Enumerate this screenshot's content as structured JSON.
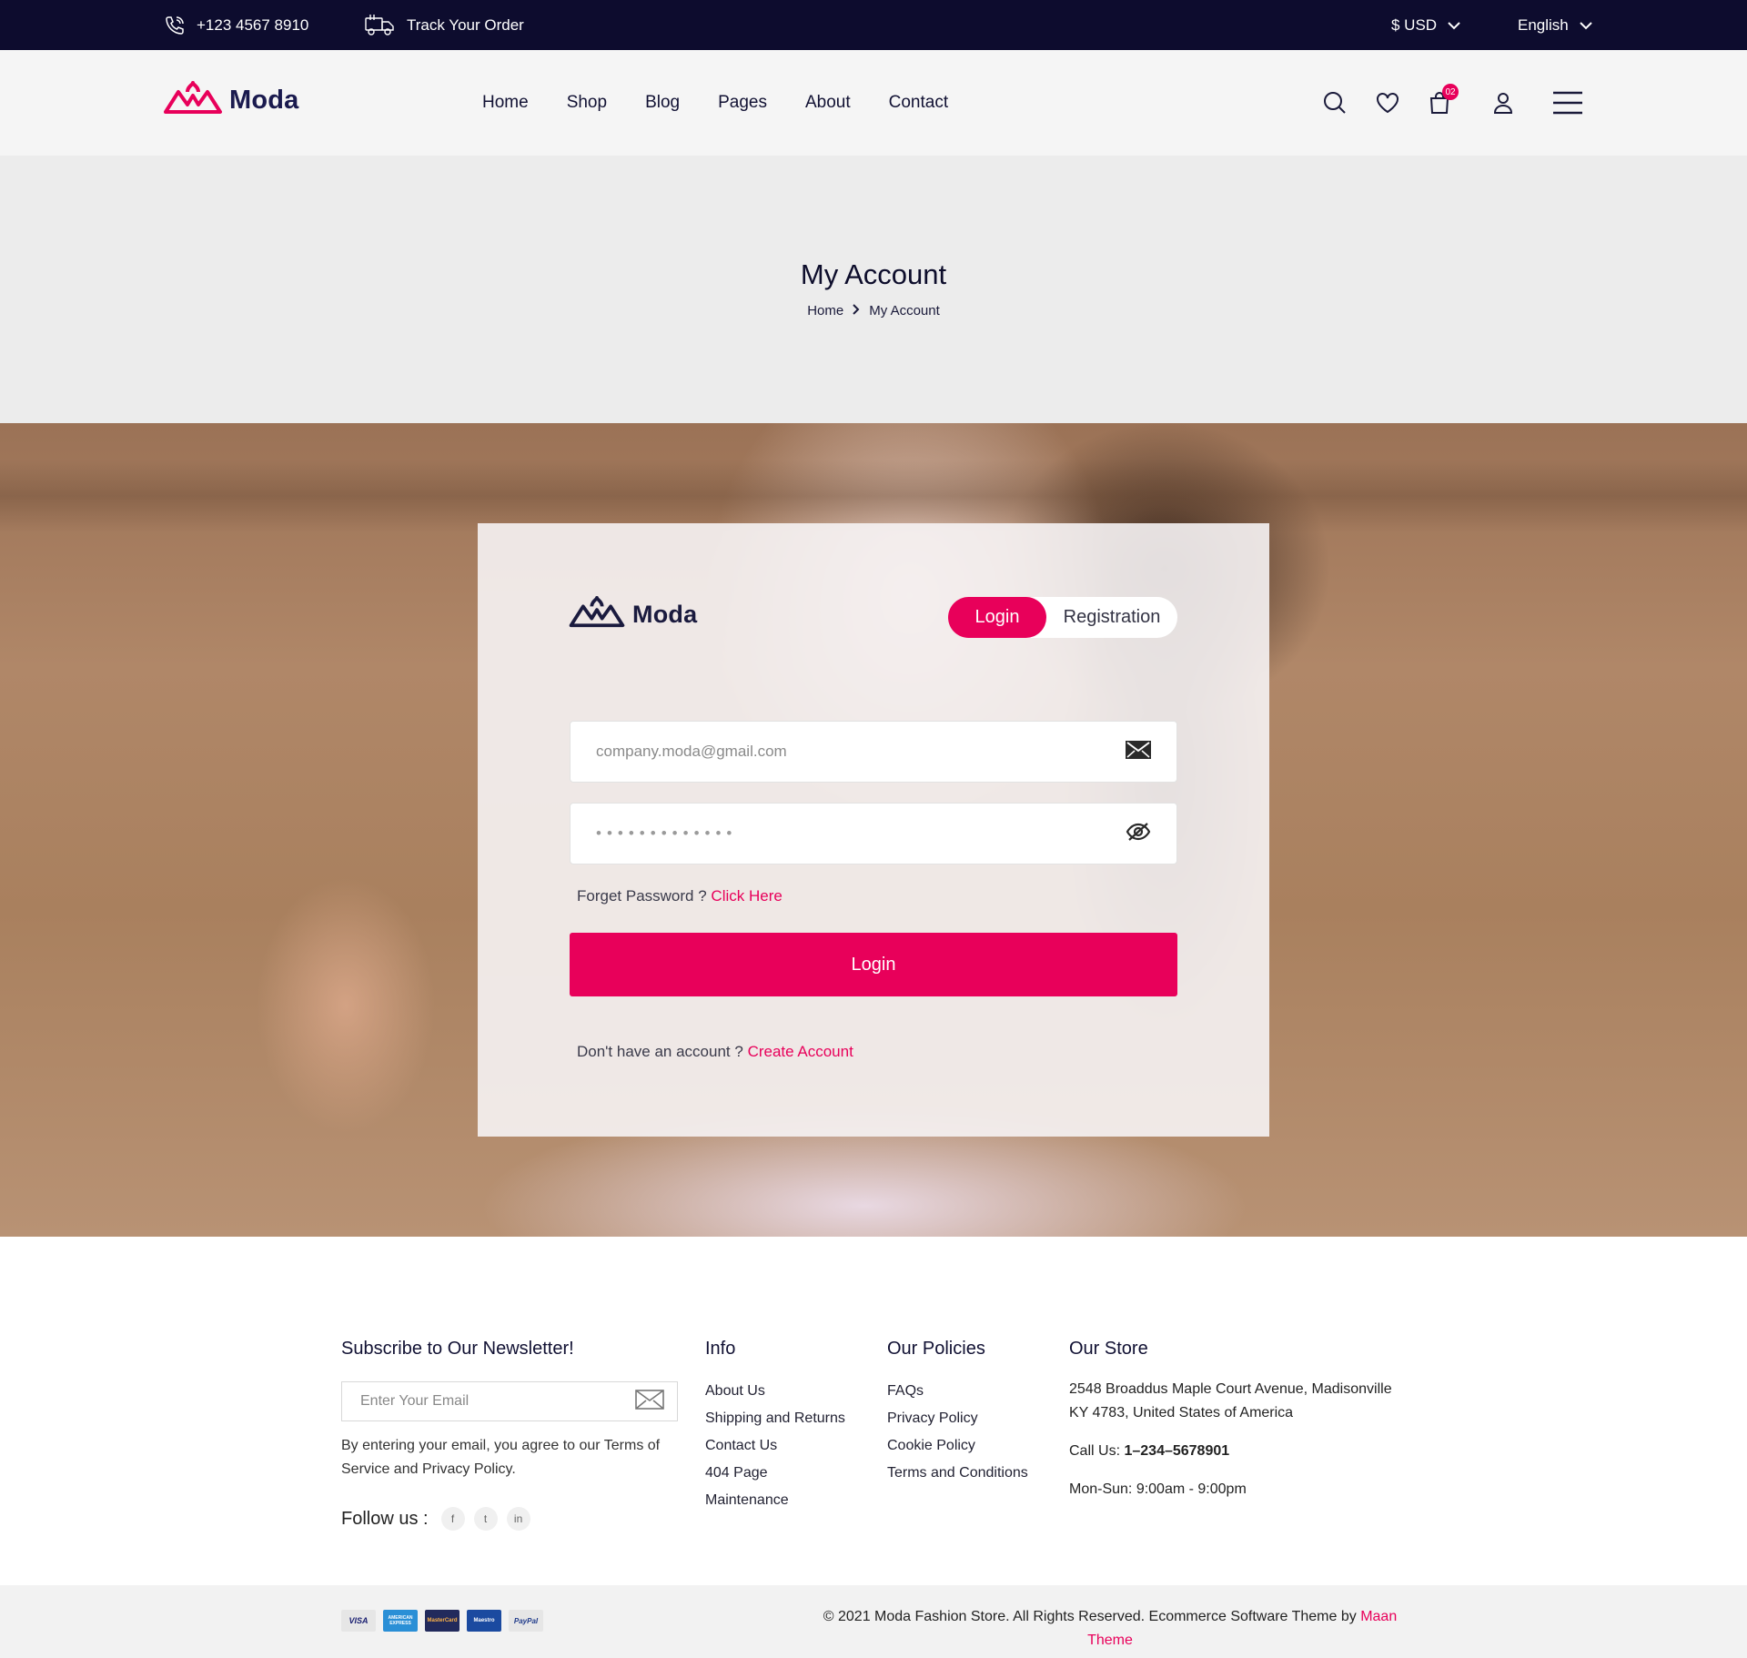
{
  "topbar": {
    "phone": "+123 4567 8910",
    "track_order": "Track Your Order",
    "currency": "$ USD",
    "language": "English"
  },
  "brand": {
    "name": "Moda"
  },
  "nav": {
    "items": [
      "Home",
      "Shop",
      "Blog",
      "Pages",
      "About",
      "Contact"
    ]
  },
  "header_icons": {
    "cart_count": "02"
  },
  "page_title": "My Account",
  "breadcrumb": {
    "home": "Home",
    "current": "My Account"
  },
  "login_card": {
    "tabs": {
      "login": "Login",
      "registration": "Registration"
    },
    "email_placeholder": "company.moda@gmail.com",
    "password_mask": "•••••••••••••",
    "forgot_text": "Forget Password ?",
    "forgot_link": "Click Here",
    "login_button": "Login",
    "no_account_text": "Don't have an account ?",
    "create_account_link": "Create Account"
  },
  "footer": {
    "newsletter": {
      "title": "Subscribe to Our Newsletter!",
      "placeholder": "Enter Your Email",
      "note": "By entering your email, you agree to our Terms of Service and Privacy Policy.",
      "follow_label": "Follow us :",
      "social": [
        "f",
        "t",
        "in"
      ]
    },
    "info": {
      "title": "Info",
      "links": [
        "About Us",
        "Shipping and Returns",
        "Contact Us",
        "404 Page",
        "Maintenance"
      ]
    },
    "policies": {
      "title": "Our Policies",
      "links": [
        "FAQs",
        "Privacy Policy",
        "Cookie Policy",
        "Terms and Conditions"
      ]
    },
    "store": {
      "title": "Our Store",
      "address": "2548 Broaddus Maple Court Avenue, Madisonville KY 4783, United States of America",
      "call_label": "Call Us:",
      "phone": "1–234–5678901",
      "hours": "Mon-Sun: 9:00am - 9:00pm"
    }
  },
  "bottombar": {
    "payments": [
      "VISA",
      "AMERICAN EXPRESS",
      "MasterCard",
      "Maestro",
      "PayPal"
    ],
    "copyright": "© 2021 Moda Fashion Store. All Rights Reserved. Ecommerce Software Theme by",
    "credit": "Maan Theme"
  },
  "colors": {
    "accent": "#e8005a",
    "topbar_bg": "#0d0c2e",
    "brand_navy": "#1a1a4e"
  }
}
